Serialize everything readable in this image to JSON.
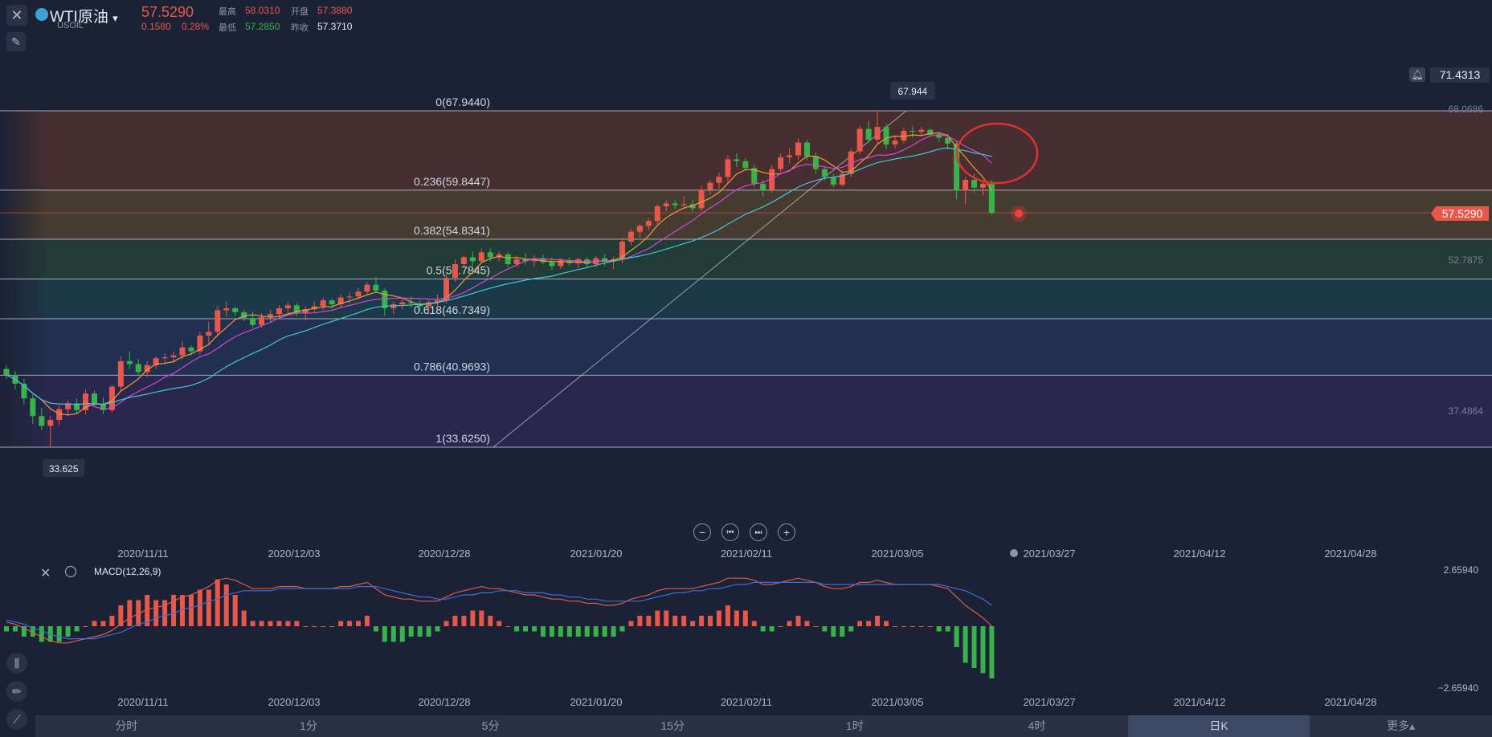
{
  "header": {
    "symbol": "WTI原油",
    "dropdown_glyph": "▾",
    "code": "USOIL",
    "price": "57.5290",
    "change": "0.1580",
    "change_pct": "0.28%",
    "high_label": "最高",
    "high": "58.0310",
    "open_label": "开盘",
    "open": "57.3880",
    "low_label": "最低",
    "low": "57.2850",
    "prev_close_label": "昨收",
    "prev_close": "57.3710"
  },
  "icons": {
    "close": "close-icon",
    "drawing_tool": "ruler-pen-icon",
    "alarm": "bell-icon",
    "zoom_out": "minus-icon",
    "jump_start": "skip-back-icon",
    "jump_end": "skip-forward-icon",
    "zoom_in": "plus-icon",
    "indicator": "candle-indicator-icon",
    "pencil": "pencil-icon",
    "trend": "trend-line-icon",
    "settings": "gear-icon"
  },
  "colors": {
    "up": "#e8574a",
    "down": "#37b34a",
    "ma5": "#f29b38",
    "ma10": "#d24ad6",
    "ma20": "#3ec8d6",
    "macd_dif": "#e05a45",
    "macd_dea": "#3b6fd8",
    "bg": "#1c2235",
    "circle": "#e2312e"
  },
  "price_axis": {
    "alarm_label": "71.4313",
    "ticks": [
      "68.0686",
      "52.7875",
      "37.4864"
    ],
    "current_tag": "57.5290"
  },
  "extremes": {
    "high_label": "67.944",
    "low_label": "33.625"
  },
  "nav_glyphs": {
    "zoom_out": "−",
    "jump_start": "⏮",
    "jump_end": "⏭",
    "zoom_in": "+"
  },
  "x_labels": [
    "2020/11/11",
    "2020/12/03",
    "2020/12/28",
    "2021/01/20",
    "2021/02/11",
    "2021/03/05",
    "2021/03/27",
    "2021/04/12",
    "2021/04/28"
  ],
  "macd": {
    "title": "MACD(12,26,9)",
    "top_label": "2.65940",
    "bottom_label": "−2.65940"
  },
  "timeframes": [
    "分时",
    "1分",
    "5分",
    "15分",
    "1时",
    "4时",
    "日K",
    "更多▴"
  ],
  "active_timeframe": "日K",
  "chart_data": {
    "type": "candlestick",
    "title": "WTI原油 USOIL",
    "x_labels": [
      "2020/11/11",
      "2020/12/03",
      "2020/12/28",
      "2021/01/20",
      "2021/02/11",
      "2021/03/05",
      "2021/03/27",
      "2021/04/12",
      "2021/04/28"
    ],
    "y_range": [
      27.0,
      75.0
    ],
    "fibonacci": [
      {
        "ratio": "0",
        "value": 67.944,
        "label": "0(67.9440)",
        "fill": "#7a3f2c"
      },
      {
        "ratio": "0.236",
        "value": 59.8447,
        "label": "0.236(59.8447)",
        "fill": "#7a5a2c"
      },
      {
        "ratio": "0.382",
        "value": 54.8341,
        "label": "0.382(54.8341)",
        "fill": "#2d5a3a"
      },
      {
        "ratio": "0.5",
        "value": 50.7845,
        "label": "0.5(50.7845)",
        "fill": "#1f5560"
      },
      {
        "ratio": "0.618",
        "value": 46.7349,
        "label": "0.618(46.7349)",
        "fill": "#274070"
      },
      {
        "ratio": "0.786",
        "value": 40.9693,
        "label": "0.786(40.9693)",
        "fill": "#3a2f6a"
      },
      {
        "ratio": "1",
        "value": 33.625,
        "label": "1(33.6250)",
        "fill": null
      }
    ],
    "candles": [
      {
        "o": 41.6,
        "h": 42.0,
        "l": 40.6,
        "c": 41.0
      },
      {
        "o": 41.0,
        "h": 41.4,
        "l": 39.5,
        "c": 40.1
      },
      {
        "o": 40.1,
        "h": 40.6,
        "l": 38.0,
        "c": 38.6
      },
      {
        "o": 38.6,
        "h": 39.0,
        "l": 36.0,
        "c": 36.8
      },
      {
        "o": 36.8,
        "h": 37.6,
        "l": 35.4,
        "c": 35.8
      },
      {
        "o": 35.8,
        "h": 36.8,
        "l": 33.625,
        "c": 36.4
      },
      {
        "o": 36.4,
        "h": 37.9,
        "l": 35.9,
        "c": 37.5
      },
      {
        "o": 37.5,
        "h": 38.4,
        "l": 36.8,
        "c": 38.1
      },
      {
        "o": 38.1,
        "h": 38.6,
        "l": 37.0,
        "c": 37.4
      },
      {
        "o": 37.4,
        "h": 39.5,
        "l": 37.0,
        "c": 39.1
      },
      {
        "o": 39.1,
        "h": 39.4,
        "l": 37.7,
        "c": 38.0
      },
      {
        "o": 38.0,
        "h": 38.7,
        "l": 37.0,
        "c": 37.4
      },
      {
        "o": 37.4,
        "h": 40.0,
        "l": 37.2,
        "c": 39.8
      },
      {
        "o": 39.8,
        "h": 42.9,
        "l": 39.4,
        "c": 42.4
      },
      {
        "o": 42.4,
        "h": 43.4,
        "l": 41.6,
        "c": 42.1
      },
      {
        "o": 42.1,
        "h": 42.6,
        "l": 40.9,
        "c": 41.3
      },
      {
        "o": 41.3,
        "h": 42.4,
        "l": 40.8,
        "c": 42.0
      },
      {
        "o": 42.0,
        "h": 42.9,
        "l": 41.6,
        "c": 42.7
      },
      {
        "o": 42.7,
        "h": 43.2,
        "l": 42.1,
        "c": 42.8
      },
      {
        "o": 42.8,
        "h": 43.4,
        "l": 42.2,
        "c": 43.0
      },
      {
        "o": 43.0,
        "h": 44.4,
        "l": 42.6,
        "c": 43.8
      },
      {
        "o": 43.8,
        "h": 44.0,
        "l": 43.0,
        "c": 43.4
      },
      {
        "o": 43.4,
        "h": 45.4,
        "l": 43.1,
        "c": 45.0
      },
      {
        "o": 45.0,
        "h": 46.4,
        "l": 44.1,
        "c": 45.4
      },
      {
        "o": 45.4,
        "h": 48.0,
        "l": 45.1,
        "c": 47.6
      },
      {
        "o": 47.6,
        "h": 48.5,
        "l": 46.9,
        "c": 47.8
      },
      {
        "o": 47.8,
        "h": 48.0,
        "l": 47.0,
        "c": 47.4
      },
      {
        "o": 47.4,
        "h": 47.6,
        "l": 46.5,
        "c": 46.8
      },
      {
        "o": 46.8,
        "h": 47.5,
        "l": 45.8,
        "c": 46.1
      },
      {
        "o": 46.1,
        "h": 47.3,
        "l": 45.8,
        "c": 46.9
      },
      {
        "o": 46.9,
        "h": 47.6,
        "l": 46.3,
        "c": 47.2
      },
      {
        "o": 47.2,
        "h": 48.1,
        "l": 46.8,
        "c": 47.8
      },
      {
        "o": 47.8,
        "h": 48.4,
        "l": 47.3,
        "c": 48.1
      },
      {
        "o": 48.1,
        "h": 48.3,
        "l": 47.0,
        "c": 47.3
      },
      {
        "o": 47.3,
        "h": 48.0,
        "l": 46.6,
        "c": 47.7
      },
      {
        "o": 47.7,
        "h": 48.5,
        "l": 47.4,
        "c": 48.0
      },
      {
        "o": 48.0,
        "h": 48.9,
        "l": 47.6,
        "c": 48.6
      },
      {
        "o": 48.6,
        "h": 48.8,
        "l": 47.8,
        "c": 48.2
      },
      {
        "o": 48.2,
        "h": 49.2,
        "l": 47.8,
        "c": 48.9
      },
      {
        "o": 48.9,
        "h": 49.4,
        "l": 48.3,
        "c": 49.0
      },
      {
        "o": 49.0,
        "h": 49.9,
        "l": 48.7,
        "c": 49.5
      },
      {
        "o": 49.5,
        "h": 50.5,
        "l": 49.1,
        "c": 50.2
      },
      {
        "o": 50.2,
        "h": 51.0,
        "l": 49.4,
        "c": 49.6
      },
      {
        "o": 49.6,
        "h": 49.9,
        "l": 47.0,
        "c": 47.8
      },
      {
        "o": 47.8,
        "h": 48.5,
        "l": 47.2,
        "c": 48.2
      },
      {
        "o": 48.2,
        "h": 48.8,
        "l": 47.7,
        "c": 48.4
      },
      {
        "o": 48.4,
        "h": 49.0,
        "l": 47.9,
        "c": 48.3
      },
      {
        "o": 48.3,
        "h": 48.6,
        "l": 47.5,
        "c": 48.0
      },
      {
        "o": 48.0,
        "h": 48.6,
        "l": 47.2,
        "c": 48.4
      },
      {
        "o": 48.4,
        "h": 49.2,
        "l": 47.9,
        "c": 48.6
      },
      {
        "o": 48.6,
        "h": 51.3,
        "l": 48.3,
        "c": 50.9
      },
      {
        "o": 50.9,
        "h": 52.8,
        "l": 50.5,
        "c": 52.3
      },
      {
        "o": 52.3,
        "h": 53.2,
        "l": 51.9,
        "c": 53.0
      },
      {
        "o": 53.0,
        "h": 53.6,
        "l": 52.1,
        "c": 52.6
      },
      {
        "o": 52.6,
        "h": 53.9,
        "l": 52.4,
        "c": 53.5
      },
      {
        "o": 53.5,
        "h": 53.9,
        "l": 52.6,
        "c": 53.0
      },
      {
        "o": 53.0,
        "h": 53.6,
        "l": 52.6,
        "c": 53.3
      },
      {
        "o": 53.3,
        "h": 53.5,
        "l": 52.0,
        "c": 52.3
      },
      {
        "o": 52.3,
        "h": 53.2,
        "l": 52.0,
        "c": 52.8
      },
      {
        "o": 52.8,
        "h": 53.4,
        "l": 52.2,
        "c": 52.6
      },
      {
        "o": 52.6,
        "h": 53.2,
        "l": 52.0,
        "c": 52.9
      },
      {
        "o": 52.9,
        "h": 53.3,
        "l": 52.3,
        "c": 52.5
      },
      {
        "o": 52.5,
        "h": 53.0,
        "l": 51.7,
        "c": 52.1
      },
      {
        "o": 52.1,
        "h": 52.9,
        "l": 51.8,
        "c": 52.7
      },
      {
        "o": 52.7,
        "h": 53.0,
        "l": 52.1,
        "c": 52.4
      },
      {
        "o": 52.4,
        "h": 53.0,
        "l": 51.9,
        "c": 52.8
      },
      {
        "o": 52.8,
        "h": 53.0,
        "l": 52.0,
        "c": 52.3
      },
      {
        "o": 52.3,
        "h": 53.1,
        "l": 52.0,
        "c": 52.9
      },
      {
        "o": 52.9,
        "h": 53.3,
        "l": 52.1,
        "c": 52.6
      },
      {
        "o": 52.6,
        "h": 53.1,
        "l": 51.8,
        "c": 52.8
      },
      {
        "o": 52.8,
        "h": 55.0,
        "l": 52.4,
        "c": 54.6
      },
      {
        "o": 54.6,
        "h": 55.9,
        "l": 54.2,
        "c": 55.6
      },
      {
        "o": 55.6,
        "h": 56.4,
        "l": 55.0,
        "c": 56.2
      },
      {
        "o": 56.2,
        "h": 57.0,
        "l": 55.8,
        "c": 56.7
      },
      {
        "o": 56.7,
        "h": 58.4,
        "l": 56.4,
        "c": 58.2
      },
      {
        "o": 58.2,
        "h": 58.8,
        "l": 57.7,
        "c": 58.5
      },
      {
        "o": 58.5,
        "h": 58.9,
        "l": 57.9,
        "c": 58.3
      },
      {
        "o": 58.3,
        "h": 59.2,
        "l": 57.9,
        "c": 58.4
      },
      {
        "o": 58.4,
        "h": 58.9,
        "l": 57.6,
        "c": 58.0
      },
      {
        "o": 58.0,
        "h": 60.3,
        "l": 57.7,
        "c": 59.9
      },
      {
        "o": 59.9,
        "h": 60.9,
        "l": 59.4,
        "c": 60.6
      },
      {
        "o": 60.6,
        "h": 61.6,
        "l": 60.0,
        "c": 61.2
      },
      {
        "o": 61.2,
        "h": 63.4,
        "l": 60.7,
        "c": 63.0
      },
      {
        "o": 63.0,
        "h": 63.6,
        "l": 62.2,
        "c": 62.8
      },
      {
        "o": 62.8,
        "h": 63.1,
        "l": 61.8,
        "c": 62.1
      },
      {
        "o": 62.1,
        "h": 62.5,
        "l": 60.1,
        "c": 60.5
      },
      {
        "o": 60.5,
        "h": 60.9,
        "l": 59.2,
        "c": 59.9
      },
      {
        "o": 59.9,
        "h": 62.4,
        "l": 59.6,
        "c": 62.0
      },
      {
        "o": 62.0,
        "h": 63.6,
        "l": 61.7,
        "c": 63.2
      },
      {
        "o": 63.2,
        "h": 64.1,
        "l": 62.6,
        "c": 63.4
      },
      {
        "o": 63.4,
        "h": 65.1,
        "l": 63.0,
        "c": 64.7
      },
      {
        "o": 64.7,
        "h": 65.0,
        "l": 62.9,
        "c": 63.3
      },
      {
        "o": 63.3,
        "h": 63.7,
        "l": 61.5,
        "c": 62.0
      },
      {
        "o": 62.0,
        "h": 62.2,
        "l": 60.8,
        "c": 61.2
      },
      {
        "o": 61.2,
        "h": 61.5,
        "l": 60.1,
        "c": 60.4
      },
      {
        "o": 60.4,
        "h": 61.8,
        "l": 60.2,
        "c": 61.5
      },
      {
        "o": 61.5,
        "h": 64.1,
        "l": 61.2,
        "c": 63.8
      },
      {
        "o": 63.8,
        "h": 66.4,
        "l": 63.5,
        "c": 66.1
      },
      {
        "o": 66.1,
        "h": 66.9,
        "l": 64.7,
        "c": 65.0
      },
      {
        "o": 65.0,
        "h": 67.944,
        "l": 64.6,
        "c": 66.3
      },
      {
        "o": 66.3,
        "h": 66.6,
        "l": 64.0,
        "c": 64.5
      },
      {
        "o": 64.5,
        "h": 65.4,
        "l": 64.1,
        "c": 64.9
      },
      {
        "o": 64.9,
        "h": 66.2,
        "l": 64.6,
        "c": 65.9
      },
      {
        "o": 65.9,
        "h": 66.4,
        "l": 65.2,
        "c": 65.8
      },
      {
        "o": 65.8,
        "h": 66.3,
        "l": 65.4,
        "c": 66.0
      },
      {
        "o": 66.0,
        "h": 66.2,
        "l": 65.3,
        "c": 65.5
      },
      {
        "o": 65.5,
        "h": 65.8,
        "l": 64.8,
        "c": 65.2
      },
      {
        "o": 65.2,
        "h": 65.6,
        "l": 64.0,
        "c": 64.6
      },
      {
        "o": 64.6,
        "h": 64.9,
        "l": 58.9,
        "c": 59.8
      },
      {
        "o": 59.8,
        "h": 61.2,
        "l": 58.4,
        "c": 60.9
      },
      {
        "o": 60.9,
        "h": 61.5,
        "l": 59.6,
        "c": 60.1
      },
      {
        "o": 60.1,
        "h": 60.8,
        "l": 59.3,
        "c": 60.5
      },
      {
        "o": 60.5,
        "h": 60.9,
        "l": 57.3,
        "c": 57.53
      }
    ],
    "macd": {
      "dif": [
        0.2,
        0.1,
        -0.1,
        -0.3,
        -0.5,
        -0.7,
        -0.8,
        -0.8,
        -0.7,
        -0.6,
        -0.5,
        -0.4,
        -0.2,
        0.1,
        0.4,
        0.6,
        0.8,
        0.9,
        1.0,
        1.2,
        1.4,
        1.5,
        1.7,
        1.9,
        2.2,
        2.3,
        2.2,
        2.0,
        1.8,
        1.8,
        1.8,
        1.9,
        1.9,
        1.9,
        1.8,
        1.8,
        1.8,
        1.8,
        1.9,
        1.9,
        2.0,
        2.1,
        1.8,
        1.5,
        1.4,
        1.3,
        1.3,
        1.2,
        1.2,
        1.2,
        1.4,
        1.6,
        1.7,
        1.8,
        1.9,
        1.8,
        1.8,
        1.7,
        1.6,
        1.5,
        1.5,
        1.4,
        1.3,
        1.3,
        1.2,
        1.2,
        1.1,
        1.1,
        1.0,
        1.0,
        1.1,
        1.3,
        1.4,
        1.5,
        1.7,
        1.8,
        1.8,
        1.8,
        1.8,
        1.9,
        2.0,
        2.1,
        2.3,
        2.3,
        2.3,
        2.2,
        2.0,
        2.0,
        2.1,
        2.2,
        2.3,
        2.2,
        2.1,
        1.9,
        1.8,
        1.8,
        1.9,
        2.1,
        2.1,
        2.2,
        2.1,
        2.0,
        2.0,
        2.0,
        2.0,
        2.0,
        1.9,
        1.8,
        1.4,
        1.0,
        0.7,
        0.4,
        0.0
      ],
      "dea": [
        0.3,
        0.2,
        0.1,
        -0.1,
        -0.2,
        -0.4,
        -0.5,
        -0.6,
        -0.6,
        -0.6,
        -0.6,
        -0.5,
        -0.4,
        -0.3,
        -0.1,
        0.1,
        0.2,
        0.4,
        0.5,
        0.6,
        0.8,
        0.9,
        1.0,
        1.2,
        1.3,
        1.5,
        1.6,
        1.7,
        1.7,
        1.7,
        1.7,
        1.8,
        1.8,
        1.8,
        1.8,
        1.8,
        1.8,
        1.8,
        1.8,
        1.8,
        1.9,
        1.9,
        1.9,
        1.8,
        1.7,
        1.6,
        1.5,
        1.4,
        1.4,
        1.3,
        1.3,
        1.4,
        1.5,
        1.5,
        1.6,
        1.6,
        1.7,
        1.7,
        1.7,
        1.6,
        1.6,
        1.6,
        1.5,
        1.5,
        1.4,
        1.4,
        1.3,
        1.3,
        1.2,
        1.2,
        1.2,
        1.2,
        1.2,
        1.3,
        1.4,
        1.5,
        1.6,
        1.6,
        1.7,
        1.7,
        1.8,
        1.8,
        1.9,
        2.0,
        2.0,
        2.1,
        2.1,
        2.1,
        2.1,
        2.1,
        2.1,
        2.1,
        2.1,
        2.0,
        2.0,
        2.0,
        2.0,
        2.0,
        2.0,
        2.0,
        2.0,
        2.0,
        2.0,
        2.0,
        2.0,
        2.0,
        2.0,
        1.9,
        1.8,
        1.7,
        1.5,
        1.3,
        1.0
      ]
    }
  }
}
